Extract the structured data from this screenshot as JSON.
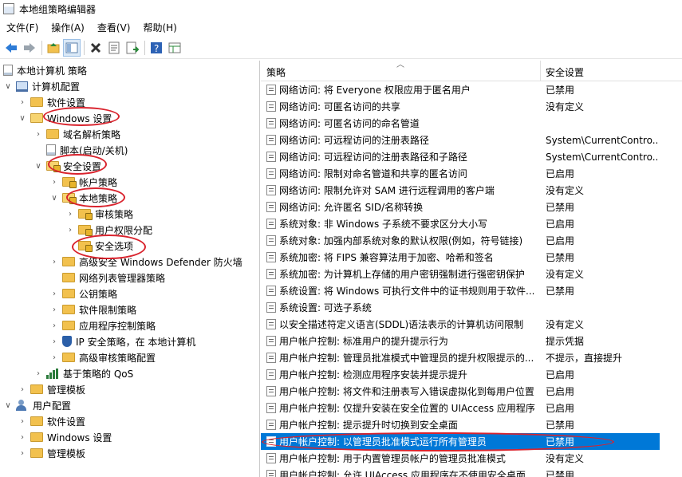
{
  "window": {
    "title": "本地组策略编辑器"
  },
  "menu": [
    "文件(F)",
    "操作(A)",
    "查看(V)",
    "帮助(H)"
  ],
  "toolbar": {
    "icons": [
      "back-arrow-icon",
      "forward-arrow-icon",
      "up-folder-icon",
      "show-hide-tree-icon",
      "delete-icon",
      "properties-icon",
      "export-list-icon",
      "help-icon",
      "view-icon"
    ]
  },
  "tree": {
    "root": "本地计算机 策略",
    "computer": "计算机配置",
    "software": "软件设置",
    "windows": "Windows 设置",
    "dns": "域名解析策略",
    "scripts": "脚本(启动/关机)",
    "security": "安全设置",
    "account": "帐户策略",
    "local": "本地策略",
    "audit": "审核策略",
    "rights": "用户权限分配",
    "options": "安全选项",
    "firewall": "高级安全 Windows Defender 防火墙",
    "netlist": "网络列表管理器策略",
    "pubkey": "公钥策略",
    "srp": "软件限制策略",
    "applocker": "应用程序控制策略",
    "ipsec": "IP 安全策略，在 本地计算机",
    "advaudit": "高级审核策略配置",
    "qos": "基于策略的 QoS",
    "admtpl": "管理模板",
    "user": "用户配置",
    "usoftware": "软件设置",
    "uwindows": "Windows 设置",
    "uadmtpl": "管理模板"
  },
  "list": {
    "columns": [
      "策略",
      "安全设置"
    ],
    "rows": [
      {
        "policy": "网络访问: 将 Everyone 权限应用于匿名用户",
        "setting": "已禁用"
      },
      {
        "policy": "网络访问: 可匿名访问的共享",
        "setting": "没有定义"
      },
      {
        "policy": "网络访问: 可匿名访问的命名管道",
        "setting": ""
      },
      {
        "policy": "网络访问: 可远程访问的注册表路径",
        "setting": "System\\CurrentContro..."
      },
      {
        "policy": "网络访问: 可远程访问的注册表路径和子路径",
        "setting": "System\\CurrentContro..."
      },
      {
        "policy": "网络访问: 限制对命名管道和共享的匿名访问",
        "setting": "已启用"
      },
      {
        "policy": "网络访问: 限制允许对 SAM 进行远程调用的客户端",
        "setting": "没有定义"
      },
      {
        "policy": "网络访问: 允许匿名 SID/名称转换",
        "setting": "已禁用"
      },
      {
        "policy": "系统对象: 非 Windows 子系统不要求区分大小写",
        "setting": "已启用"
      },
      {
        "policy": "系统对象: 加强内部系统对象的默认权限(例如，符号链接)",
        "setting": "已启用"
      },
      {
        "policy": "系统加密: 将 FIPS 兼容算法用于加密、哈希和签名",
        "setting": "已禁用"
      },
      {
        "policy": "系统加密: 为计算机上存储的用户密钥强制进行强密钥保护",
        "setting": "没有定义"
      },
      {
        "policy": "系统设置: 将 Windows 可执行文件中的证书规则用于软件...",
        "setting": "已禁用"
      },
      {
        "policy": "系统设置: 可选子系统",
        "setting": ""
      },
      {
        "policy": "以安全描述符定义语言(SDDL)语法表示的计算机访问限制",
        "setting": "没有定义"
      },
      {
        "policy": "用户帐户控制: 标准用户的提升提示行为",
        "setting": "提示凭据"
      },
      {
        "policy": "用户帐户控制: 管理员批准模式中管理员的提升权限提示的...",
        "setting": "不提示，直接提升"
      },
      {
        "policy": "用户帐户控制: 检测应用程序安装并提示提升",
        "setting": "已启用"
      },
      {
        "policy": "用户帐户控制: 将文件和注册表写入错误虚拟化到每用户位置",
        "setting": "已启用"
      },
      {
        "policy": "用户帐户控制: 仅提升安装在安全位置的 UIAccess 应用程序",
        "setting": "已启用"
      },
      {
        "policy": "用户帐户控制: 提示提升时切换到安全桌面",
        "setting": "已禁用"
      },
      {
        "policy": "用户帐户控制: 以管理员批准模式运行所有管理员",
        "setting": "已禁用"
      },
      {
        "policy": "用户帐户控制: 用于内置管理员帐户的管理员批准模式",
        "setting": "没有定义"
      },
      {
        "policy": "用户帐户控制: 允许 UIAccess 应用程序在不使用安全桌面...",
        "setting": "已禁用"
      }
    ]
  },
  "colors": {
    "selection": "#0078d7",
    "annotation": "#d9232d",
    "folder": "#f2c14e"
  }
}
